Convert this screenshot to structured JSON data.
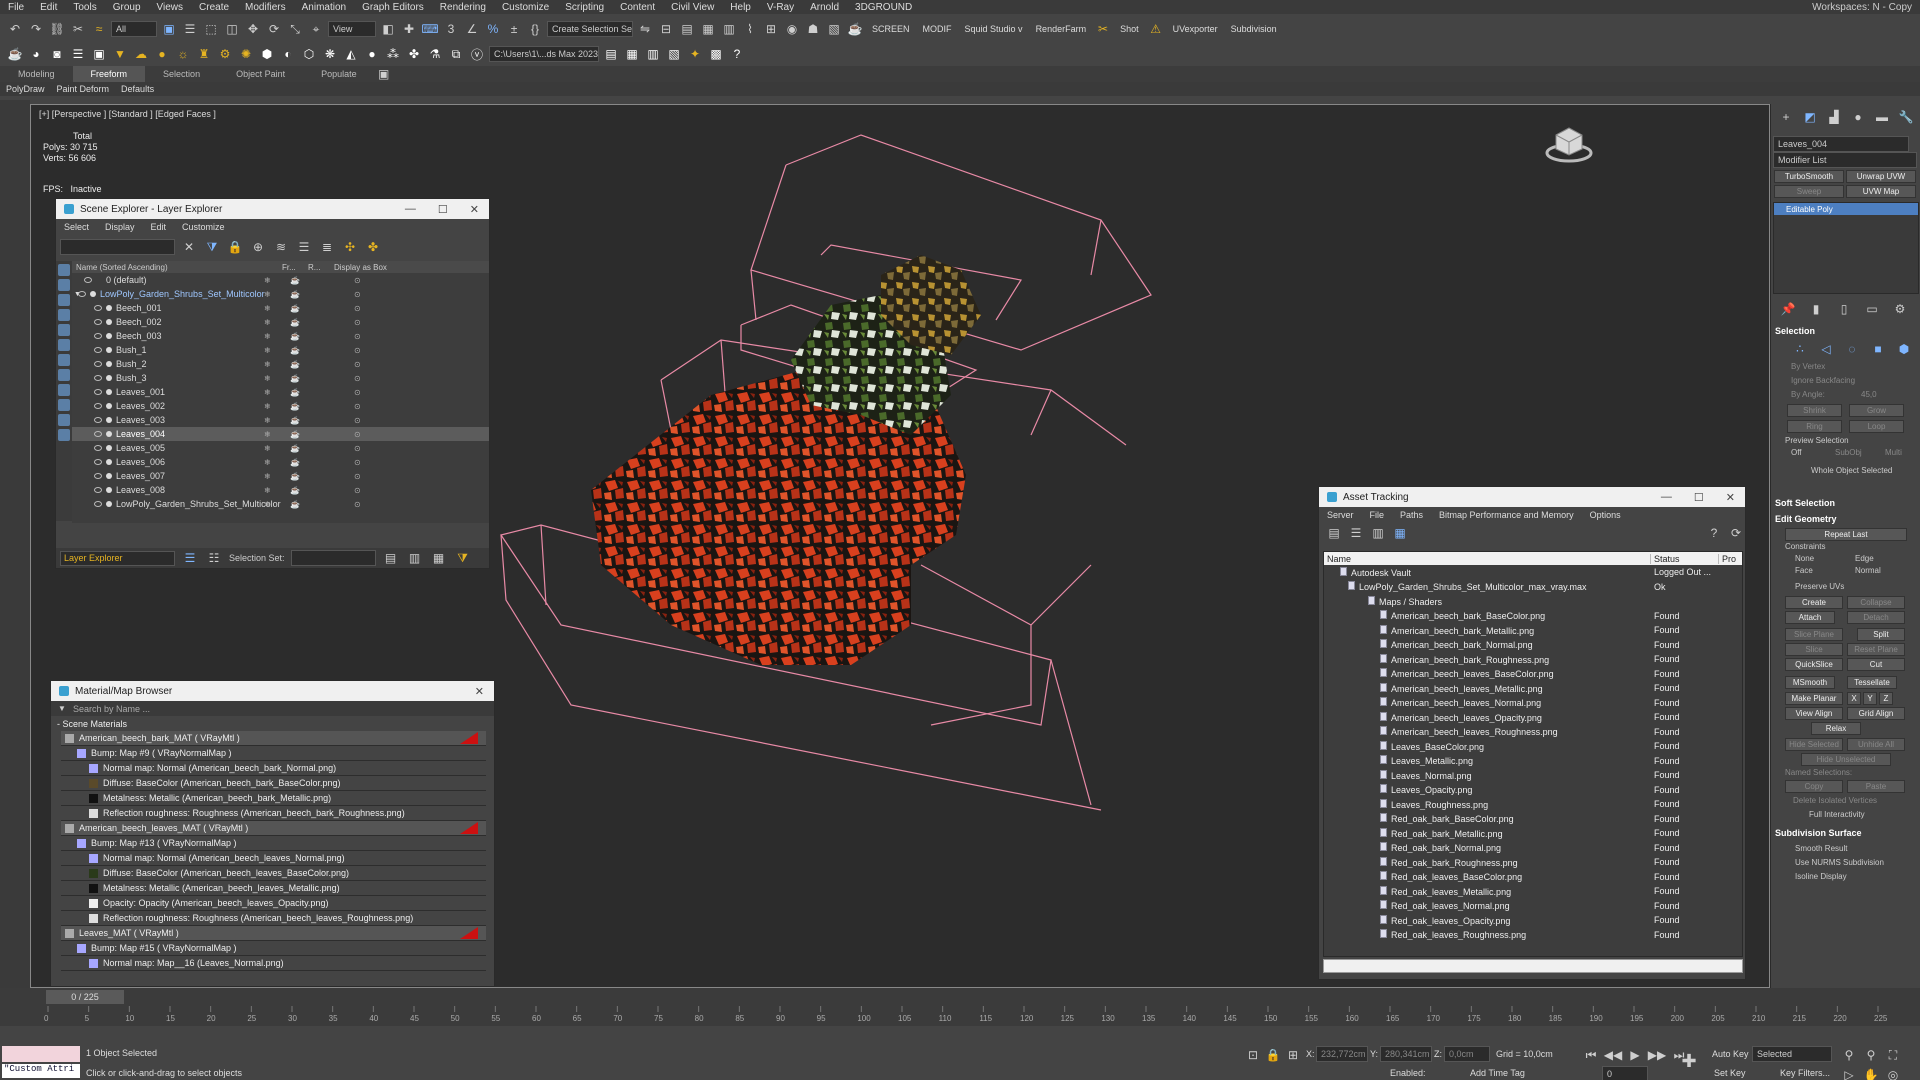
{
  "menu": [
    "File",
    "Edit",
    "Tools",
    "Group",
    "Views",
    "Create",
    "Modifiers",
    "Animation",
    "Graph Editors",
    "Rendering",
    "Customize",
    "Scripting",
    "Content",
    "Civil View",
    "Help",
    "V-Ray",
    "Arnold",
    "3DGROUND"
  ],
  "workspace": "Workspaces:  N - Copy",
  "toolbar": {
    "filter": "All",
    "refcoord": "View",
    "selset": "Create Selection Se",
    "screen": "SCREEN",
    "modif": "MODIF",
    "squid": "Squid Studio v",
    "renderfarm": "RenderFarm",
    "shot": "Shot",
    "uvexporter": "UVexporter",
    "subdivision": "Subdivision",
    "path": "C:\\Users\\1\\...ds Max 2023"
  },
  "ribbon_tabs": [
    "Modeling",
    "Freeform",
    "Selection",
    "Object Paint",
    "Populate"
  ],
  "subribbon": [
    "PolyDraw",
    "Paint Deform",
    "Defaults"
  ],
  "viewport": {
    "label": "[+] [Perspective ] [Standard ] [Edged Faces ]",
    "total": "Total",
    "polys_label": "Polys:",
    "polys": "30 715",
    "verts_label": "Verts:",
    "verts": "56 606",
    "fps_label": "FPS:",
    "fps": "Inactive"
  },
  "scene_explorer": {
    "title": "Scene Explorer - Layer Explorer",
    "menu": [
      "Select",
      "Display",
      "Edit",
      "Customize"
    ],
    "headers": {
      "name": "Name (Sorted Ascending)",
      "frozen": "Fr...",
      "render": "R...",
      "box": "Display as Box"
    },
    "rows": [
      "0 (default)",
      "LowPoly_Garden_Shrubs_Set_Multicolor",
      "Beech_001",
      "Beech_002",
      "Beech_003",
      "Bush_1",
      "Bush_2",
      "Bush_3",
      "Leaves_001",
      "Leaves_002",
      "Leaves_003",
      "Leaves_004",
      "Leaves_005",
      "Leaves_006",
      "Leaves_007",
      "Leaves_008",
      "LowPoly_Garden_Shrubs_Set_Multicolor"
    ],
    "layer_explorer": "Layer Explorer",
    "selection_set": "Selection Set:"
  },
  "material_browser": {
    "title": "Material/Map Browser",
    "search": "Search by Name ...",
    "section": "- Scene Materials",
    "rows": [
      "American_beech_bark_MAT ( VRayMtl )",
      "Bump: Map #9 ( VRayNormalMap )",
      "Normal map: Normal (American_beech_bark_Normal.png)",
      "Diffuse: BaseColor (American_beech_bark_BaseColor.png)",
      "Metalness: Metallic (American_beech_bark_Metallic.png)",
      "Reflection roughness: Roughness (American_beech_bark_Roughness.png)",
      "American_beech_leaves_MAT ( VRayMtl )",
      "Bump: Map #13 ( VRayNormalMap )",
      "Normal map: Normal (American_beech_leaves_Normal.png)",
      "Diffuse: BaseColor (American_beech_leaves_BaseColor.png)",
      "Metalness: Metallic (American_beech_leaves_Metallic.png)",
      "Opacity: Opacity (American_beech_leaves_Opacity.png)",
      "Reflection roughness: Roughness (American_beech_leaves_Roughness.png)",
      "Leaves_MAT ( VRayMtl )",
      "Bump: Map #15 ( VRayNormalMap )",
      "Normal map: Map__16 (Leaves_Normal.png)"
    ]
  },
  "asset_tracking": {
    "title": "Asset Tracking",
    "menu": [
      "Server",
      "File",
      "Paths",
      "Bitmap Performance and Memory",
      "Options"
    ],
    "headers": {
      "name": "Name",
      "status": "Status",
      "pro": "Pro"
    },
    "rows": [
      {
        "name": "Autodesk Vault",
        "status": "Logged Out ..."
      },
      {
        "name": "LowPoly_Garden_Shrubs_Set_Multicolor_max_vray.max",
        "status": "Ok"
      },
      {
        "name": "Maps / Shaders",
        "status": ""
      },
      {
        "name": "American_beech_bark_BaseColor.png",
        "status": "Found"
      },
      {
        "name": "American_beech_bark_Metallic.png",
        "status": "Found"
      },
      {
        "name": "American_beech_bark_Normal.png",
        "status": "Found"
      },
      {
        "name": "American_beech_bark_Roughness.png",
        "status": "Found"
      },
      {
        "name": "American_beech_leaves_BaseColor.png",
        "status": "Found"
      },
      {
        "name": "American_beech_leaves_Metallic.png",
        "status": "Found"
      },
      {
        "name": "American_beech_leaves_Normal.png",
        "status": "Found"
      },
      {
        "name": "American_beech_leaves_Opacity.png",
        "status": "Found"
      },
      {
        "name": "American_beech_leaves_Roughness.png",
        "status": "Found"
      },
      {
        "name": "Leaves_BaseColor.png",
        "status": "Found"
      },
      {
        "name": "Leaves_Metallic.png",
        "status": "Found"
      },
      {
        "name": "Leaves_Normal.png",
        "status": "Found"
      },
      {
        "name": "Leaves_Opacity.png",
        "status": "Found"
      },
      {
        "name": "Leaves_Roughness.png",
        "status": "Found"
      },
      {
        "name": "Red_oak_bark_BaseColor.png",
        "status": "Found"
      },
      {
        "name": "Red_oak_bark_Metallic.png",
        "status": "Found"
      },
      {
        "name": "Red_oak_bark_Normal.png",
        "status": "Found"
      },
      {
        "name": "Red_oak_bark_Roughness.png",
        "status": "Found"
      },
      {
        "name": "Red_oak_leaves_BaseColor.png",
        "status": "Found"
      },
      {
        "name": "Red_oak_leaves_Metallic.png",
        "status": "Found"
      },
      {
        "name": "Red_oak_leaves_Normal.png",
        "status": "Found"
      },
      {
        "name": "Red_oak_leaves_Opacity.png",
        "status": "Found"
      },
      {
        "name": "Red_oak_leaves_Roughness.png",
        "status": "Found"
      }
    ]
  },
  "command_panel": {
    "object_name": "Leaves_004",
    "modifier_list": "Modifier List",
    "btn_turbosmooth": "TurboSmooth",
    "btn_unwrap": "Unwrap UVW",
    "btn_sweep": "Sweep",
    "btn_uvwmap": "UVW Map",
    "stack_item": "Editable Poly",
    "sec_selection": "Selection",
    "by_vertex": "By Vertex",
    "ignore_backfacing": "Ignore Backfacing",
    "by_angle": "By Angle:",
    "by_angle_val": "45,0",
    "shrink": "Shrink",
    "grow": "Grow",
    "ring": "Ring",
    "loop": "Loop",
    "preview_selection": "Preview Selection",
    "off": "Off",
    "subobj": "SubObj",
    "multi": "Multi",
    "whole_object": "Whole Object Selected",
    "sec_soft": "Soft Selection",
    "sec_edit_geom": "Edit Geometry",
    "repeat_last": "Repeat Last",
    "constraints": "Constraints",
    "none": "None",
    "edge": "Edge",
    "face": "Face",
    "normal": "Normal",
    "preserve_uvs": "Preserve UVs",
    "create": "Create",
    "collapse": "Collapse",
    "attach": "Attach",
    "detach": "Detach",
    "slice_plane": "Slice Plane",
    "split": "Split",
    "slice": "Slice",
    "reset_plane": "Reset Plane",
    "quickslice": "QuickSlice",
    "cut": "Cut",
    "msmooth": "MSmooth",
    "tessellate": "Tessellate",
    "make_planar": "Make Planar",
    "x": "X",
    "y": "Y",
    "z": "Z",
    "view_align": "View Align",
    "grid_align": "Grid Align",
    "relax": "Relax",
    "hide_selected": "Hide Selected",
    "unhide_all": "Unhide All",
    "hide_unselected": "Hide Unselected",
    "named_selections": "Named Selections:",
    "copy": "Copy",
    "paste": "Paste",
    "delete_isolated": "Delete Isolated Vertices",
    "full_interactivity": "Full Interactivity",
    "sec_subdiv": "Subdivision Surface",
    "smooth_result": "Smooth Result",
    "use_nurms": "Use NURMS Subdivision",
    "isoline": "Isoline Display"
  },
  "timeline": {
    "slider": "0 / 225",
    "ticks": [
      "0",
      "5",
      "10",
      "15",
      "20",
      "25",
      "30",
      "35",
      "40",
      "45",
      "50",
      "55",
      "60",
      "65",
      "70",
      "75",
      "80",
      "85",
      "90",
      "95",
      "100",
      "105",
      "110",
      "115",
      "120",
      "125",
      "130",
      "135",
      "140",
      "145",
      "150",
      "155",
      "160",
      "165",
      "170",
      "175",
      "180",
      "185",
      "190",
      "195",
      "200",
      "205",
      "210",
      "215",
      "220",
      "225"
    ]
  },
  "status": {
    "maxscript": "\"Custom Attri",
    "selected": "1 Object Selected",
    "hint": "Click or click-and-drag to select objects",
    "x_label": "X:",
    "x_val": "232,772cm",
    "y_label": "Y:",
    "y_val": "280,341cm",
    "z_label": "Z:",
    "z_val": "0,0cm",
    "grid": "Grid = 10,0cm",
    "enabled": "Enabled:",
    "add_time_tag": "Add Time Tag",
    "auto_key": "Auto Key",
    "selected_combo": "Selected",
    "set_key": "Set Key",
    "key_filters": "Key Filters...",
    "frame": "0"
  }
}
